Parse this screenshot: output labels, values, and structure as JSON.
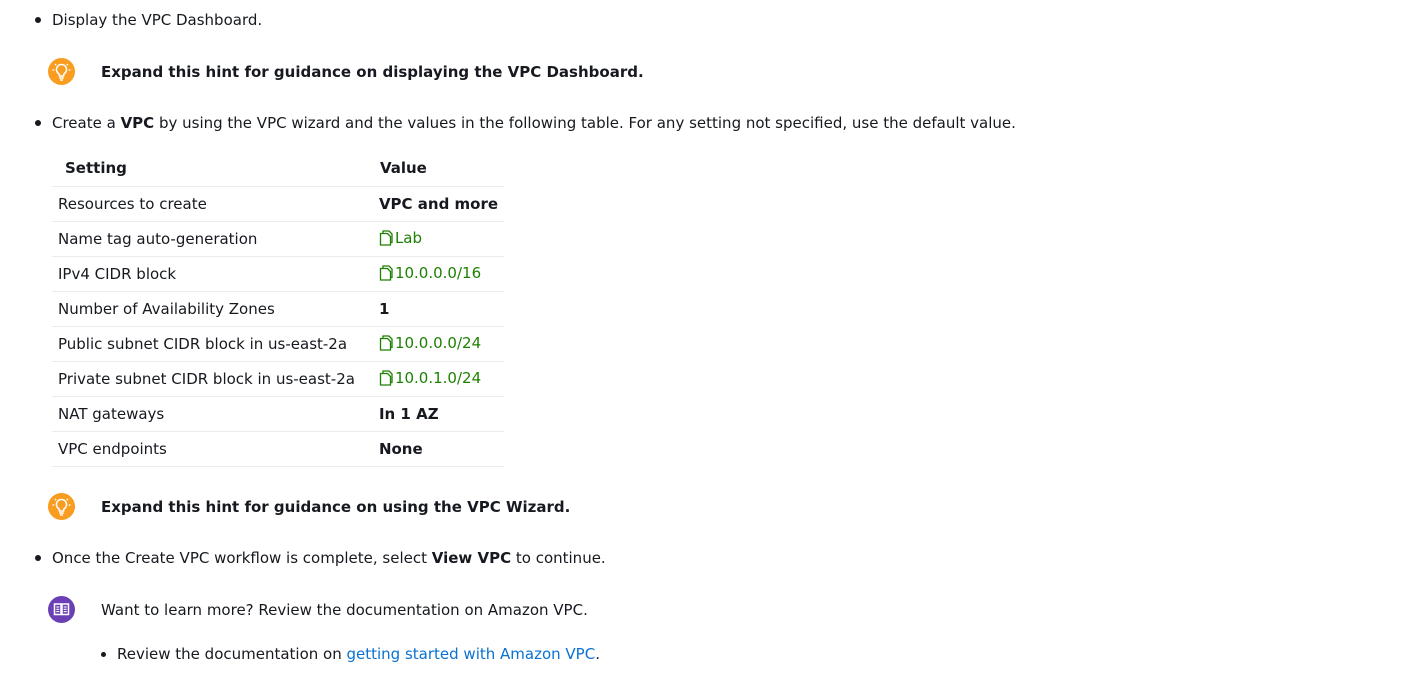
{
  "steps": {
    "display_dashboard": "Display the VPC Dashboard.",
    "hint_dashboard": "Expand this hint for guidance on displaying the VPC Dashboard.",
    "create_vpc": {
      "prefix": "Create a ",
      "bold": "VPC",
      "suffix": " by using the VPC wizard and the values in the following table. For any setting not specified, use the default value."
    },
    "hint_wizard": "Expand this hint for guidance on using the VPC Wizard.",
    "view_vpc": {
      "prefix": "Once the Create VPC workflow is complete, select ",
      "bold": "View VPC",
      "suffix": " to continue."
    },
    "learn_more": "Want to learn more? Review the documentation on Amazon VPC.",
    "review_doc": {
      "prefix": "Review the documentation on ",
      "link": "getting started with Amazon VPC",
      "suffix": "."
    }
  },
  "table": {
    "headers": [
      "Setting",
      "Value"
    ],
    "rows": [
      {
        "setting": "Resources to create",
        "value": "VPC and more",
        "style": "bold"
      },
      {
        "setting": "Name tag auto-generation",
        "value": "Lab",
        "style": "copy"
      },
      {
        "setting": "IPv4 CIDR block",
        "value": "10.0.0.0/16",
        "style": "copy"
      },
      {
        "setting": "Number of Availability Zones",
        "value": "1",
        "style": "bold"
      },
      {
        "setting": "Public subnet CIDR block in us-east-2a",
        "value": "10.0.0.0/24",
        "style": "copy"
      },
      {
        "setting": "Private subnet CIDR block in us-east-2a",
        "value": "10.0.1.0/24",
        "style": "copy"
      },
      {
        "setting": "NAT gateways",
        "value": "In 1 AZ",
        "style": "bold"
      },
      {
        "setting": "VPC endpoints",
        "value": "None",
        "style": "bold"
      }
    ]
  },
  "icons": {
    "hint": "lightbulb-icon",
    "docs": "book-icon",
    "copy": "copy-icon"
  },
  "colors": {
    "hint_bg": "#f89d1f",
    "docs_bg": "#6b40b4",
    "copy_green": "#1d8102",
    "link_blue": "#0972d3"
  }
}
